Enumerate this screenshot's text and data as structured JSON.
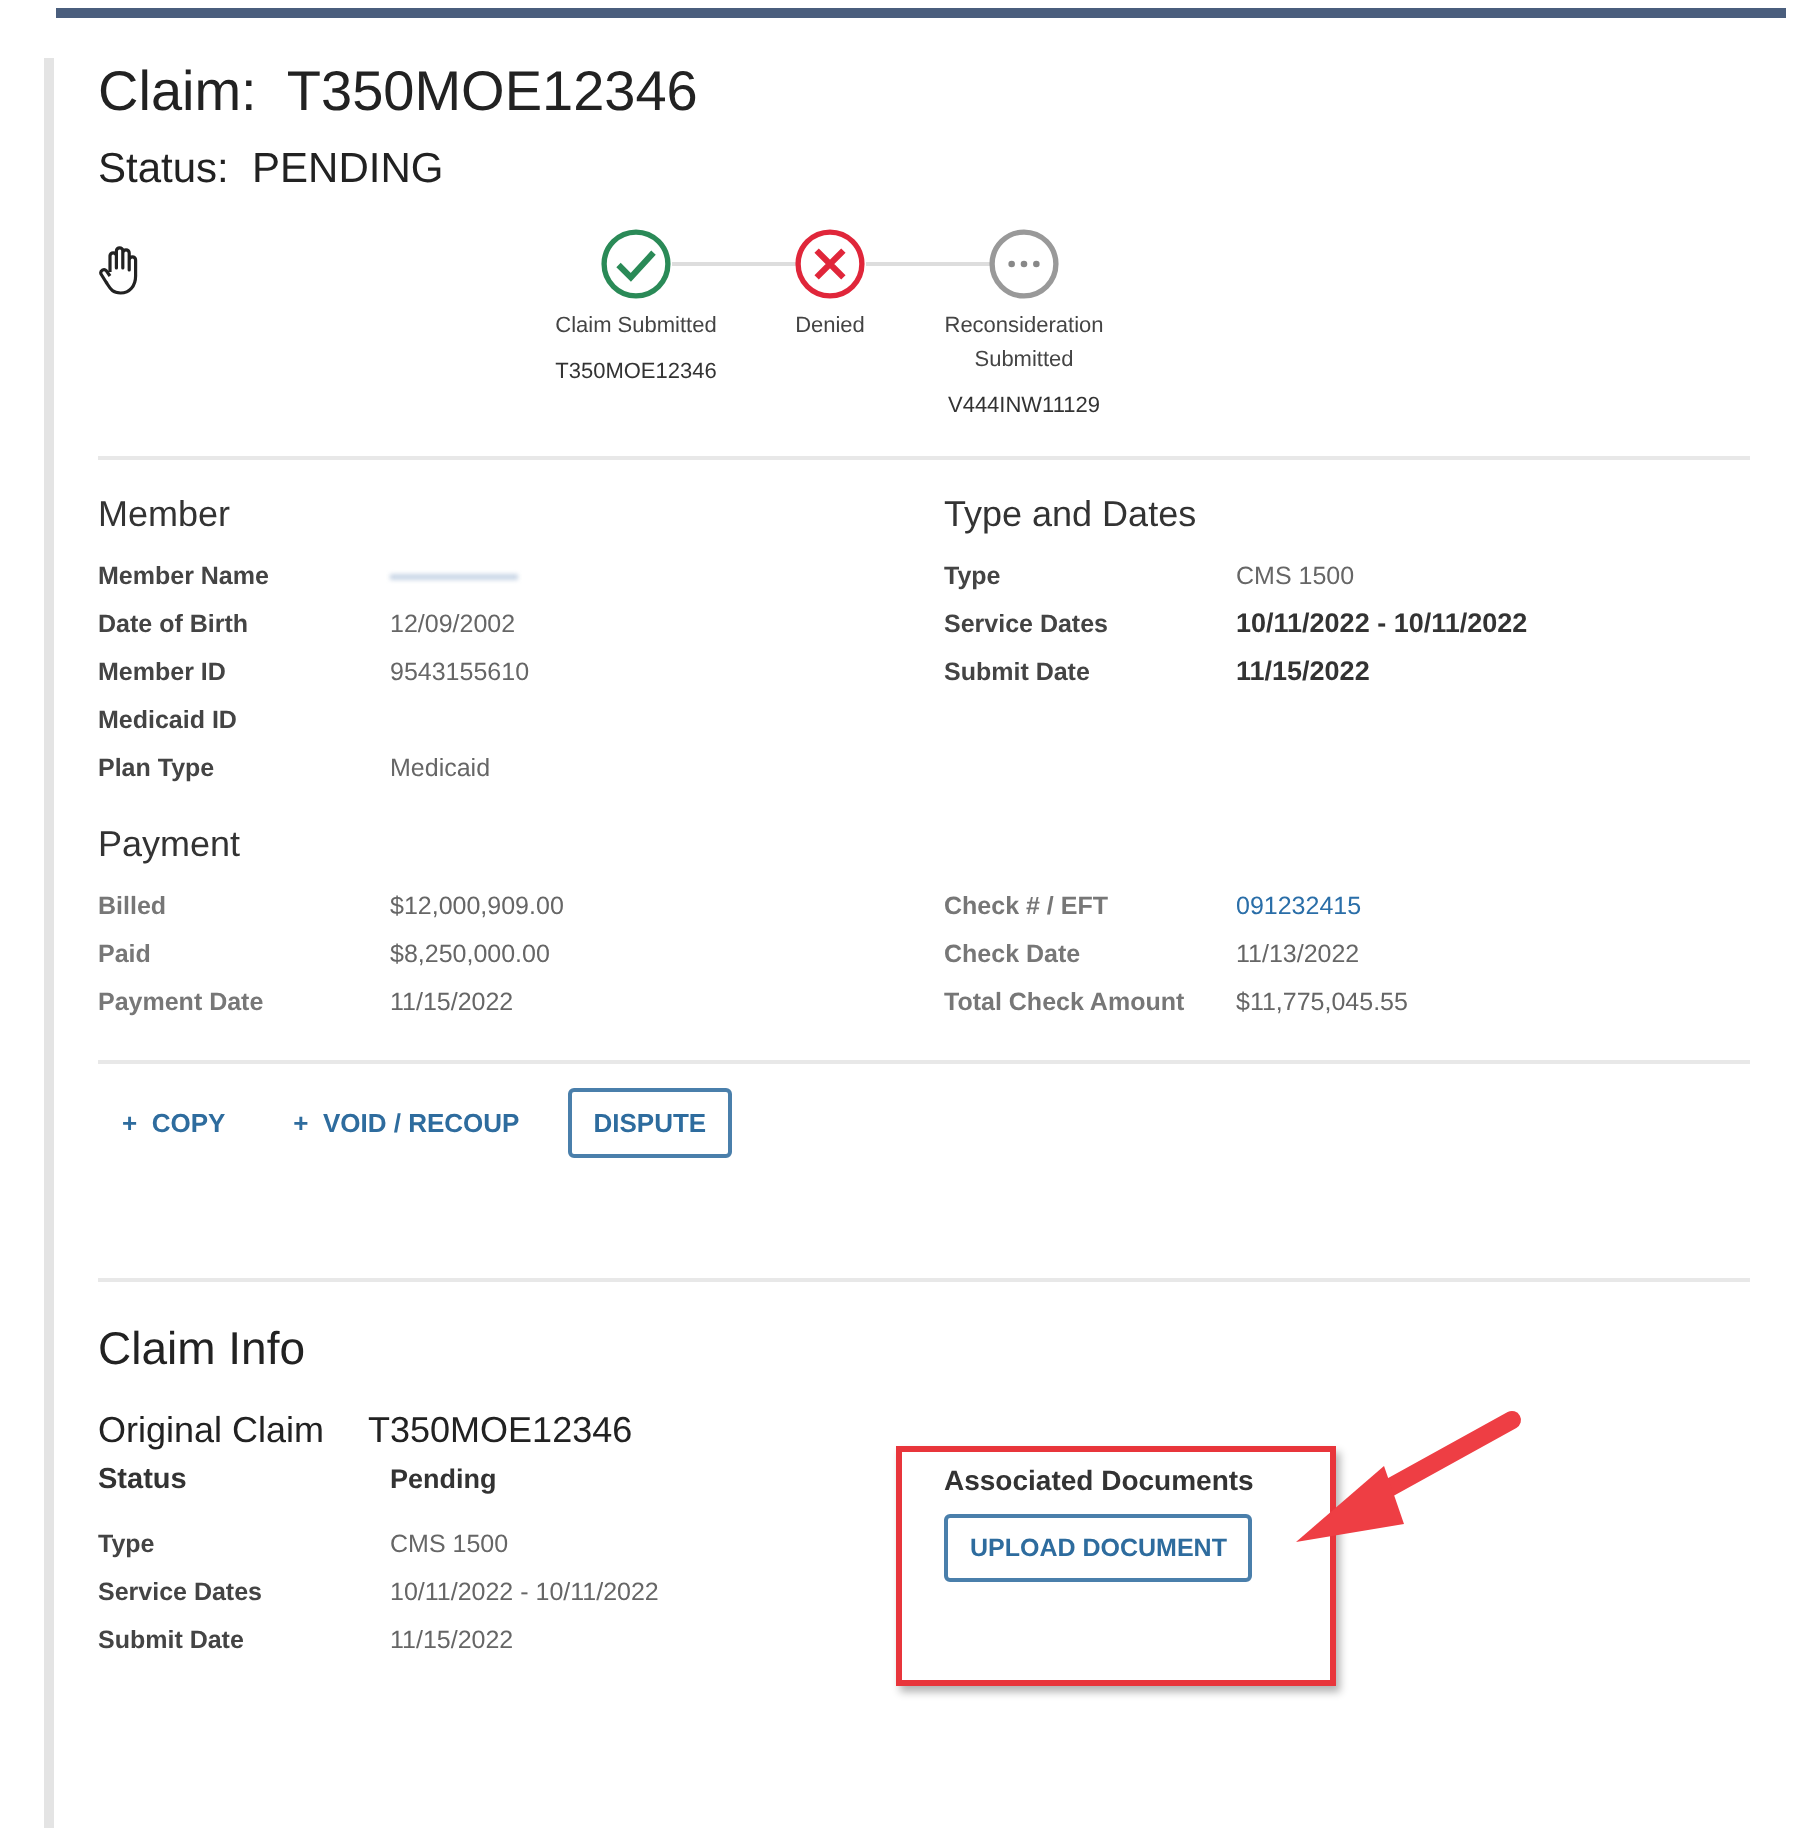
{
  "header": {
    "claim_label": "Claim:",
    "claim_id": "T350MOE12346",
    "status_label": "Status:",
    "status": "PENDING"
  },
  "timeline": [
    {
      "kind": "done",
      "label": "Claim Submitted",
      "ref": "T350MOE12346"
    },
    {
      "kind": "denied",
      "label": "Denied"
    },
    {
      "kind": "pending",
      "label": "Reconsideration Submitted",
      "ref": "V444INW11129"
    }
  ],
  "section_rows": [
    [
      {
        "title": "Member",
        "fields": [
          {
            "label": "Member Name",
            "redacted": true
          },
          {
            "label": "Date of Birth",
            "value": "12/09/2002"
          },
          {
            "label": "Member ID",
            "value": "9543155610"
          },
          {
            "label": "Medicaid ID"
          },
          {
            "label": "Plan Type",
            "value": "Medicaid"
          }
        ]
      },
      {
        "title": "Type and Dates",
        "fields": [
          {
            "label": "Type",
            "value": "CMS 1500"
          },
          {
            "label": "Service Dates",
            "value": "10/11/2022 - 10/11/2022",
            "bold": true
          },
          {
            "label": "Submit Date",
            "value": "11/15/2022",
            "bold": true
          }
        ]
      }
    ],
    [
      {
        "title": "Payment",
        "muted": true,
        "fields": [
          {
            "label": "Billed",
            "value": "$12,000,909.00"
          },
          {
            "label": "Paid",
            "value": "$8,250,000.00"
          },
          {
            "label": "Payment Date",
            "value": "11/15/2022"
          }
        ]
      },
      {
        "muted": true,
        "fields": [
          {
            "label": "Check # / EFT",
            "value": "091232415",
            "kind": "link"
          },
          {
            "label": "Check Date",
            "value": "11/13/2022"
          },
          {
            "label": "Total Check Amount",
            "value": "$11,775,045.55"
          }
        ]
      }
    ]
  ],
  "actions": [
    {
      "kind": "text",
      "icon": "+",
      "label": "COPY"
    },
    {
      "kind": "text",
      "icon": "+",
      "label": "VOID / RECOUP"
    },
    {
      "kind": "outline",
      "label": "DISPUTE"
    }
  ],
  "claim_info": {
    "title": "Claim Info",
    "original_label": "Original Claim",
    "original_id": "T350MOE12346",
    "status_label": "Status",
    "status": "Pending",
    "fields": [
      {
        "label": "Type",
        "value": "CMS 1500"
      },
      {
        "label": "Service Dates",
        "value": "10/11/2022 - 10/11/2022"
      },
      {
        "label": "Submit Date",
        "value": "11/15/2022"
      }
    ],
    "documents_title": "Associated Documents",
    "upload_button": "UPLOAD DOCUMENT",
    "highlighted": true
  }
}
